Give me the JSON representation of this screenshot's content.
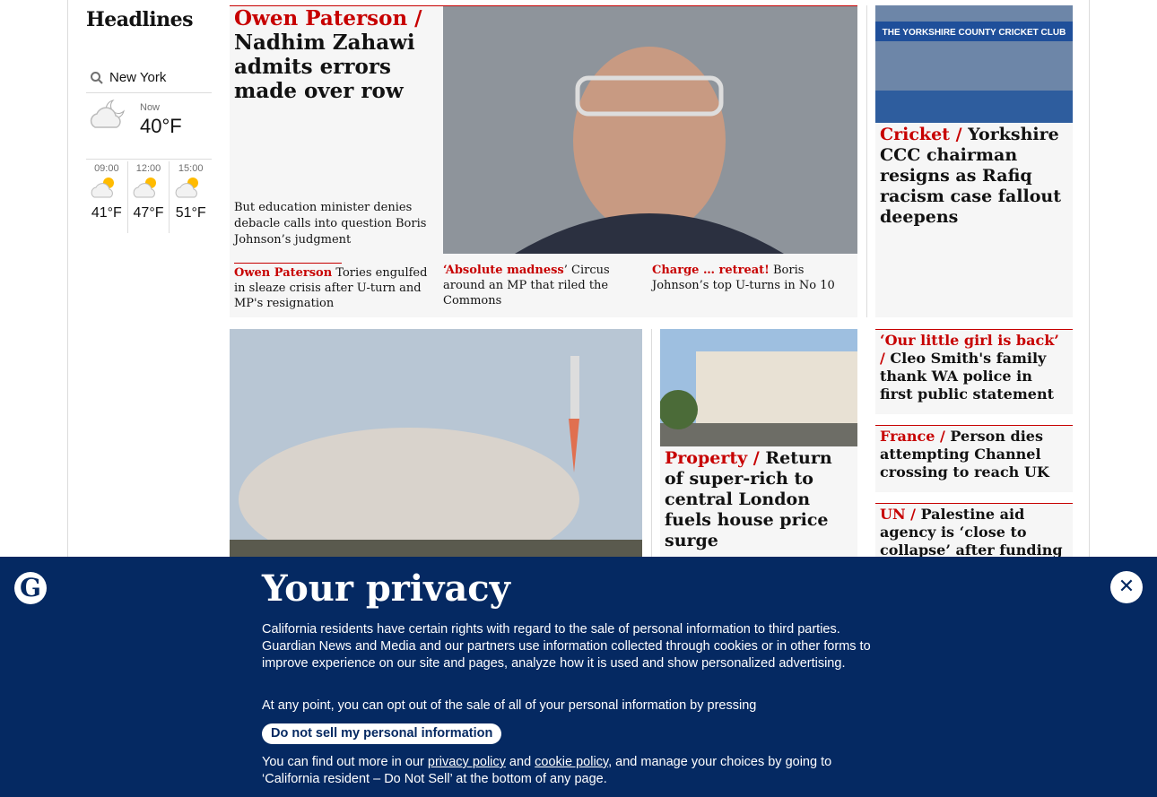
{
  "sidebar": {
    "title": "Headlines",
    "location": "New York",
    "now_label": "Now",
    "now_temp": "40°F",
    "forecast": [
      {
        "time": "09:00",
        "temp": "41°F"
      },
      {
        "time": "12:00",
        "temp": "47°F"
      },
      {
        "time": "15:00",
        "temp": "51°F"
      }
    ]
  },
  "lead": {
    "kicker": "Owen Paterson /",
    "headline": "Nadhim Zahawi admits errors made over row",
    "standfirst": "But education minister denies debacle calls into question Boris Johnson’s judgment"
  },
  "sublinks": [
    {
      "kicker": "Owen Paterson",
      "text": " Tories engulfed in sleaze crisis after U-turn and MP's resignation"
    },
    {
      "kicker": "‘Absolute madness",
      "text": "’ Circus around an MP that riled the Commons"
    },
    {
      "kicker": "Charge … retreat!",
      "text": " Boris Johnson’s top U-turns in No 10"
    }
  ],
  "cricket": {
    "image_text": "THE YORKSHIRE COUNTY CRICKET CLUB",
    "kicker": "Cricket /",
    "headline": " Yorkshire CCC chairman resigns as Rafiq racism case fallout deepens"
  },
  "property": {
    "kicker": "Property /",
    "headline": " Return of super-rich to central London fuels house price surge"
  },
  "side_stories": [
    {
      "kicker": "‘Our little girl is back’ /",
      "headline": " Cleo Smith's family thank WA police in first public statement"
    },
    {
      "kicker": "France /",
      "headline": " Person dies attempting Channel crossing to reach UK"
    },
    {
      "kicker": "UN  /",
      "headline": " Palestine aid agency is ‘close to collapse’ after funding cuts"
    }
  ],
  "banner": {
    "logo": "G",
    "title": "Your privacy",
    "p1": "California residents have certain rights with regard to the sale of personal information to third parties. Guardian News and Media and our partners use information collected through cookies or in other forms to improve experience on our site and pages, analyze how it is used and show personalized advertising.",
    "p2": "At any point, you can opt out of the sale of all of your personal information by pressing",
    "button": "Do not sell my personal information",
    "p3a": "You can find out more in our ",
    "privacy_link": "privacy policy",
    "p3b": " and ",
    "cookie_link": "cookie policy",
    "p3c": ", and manage your choices by going to ‘California resident – Do Not Sell’ at the bottom of any page.",
    "close": "✕"
  },
  "colors": {
    "accent": "#c70000",
    "banner_bg": "#052962"
  }
}
